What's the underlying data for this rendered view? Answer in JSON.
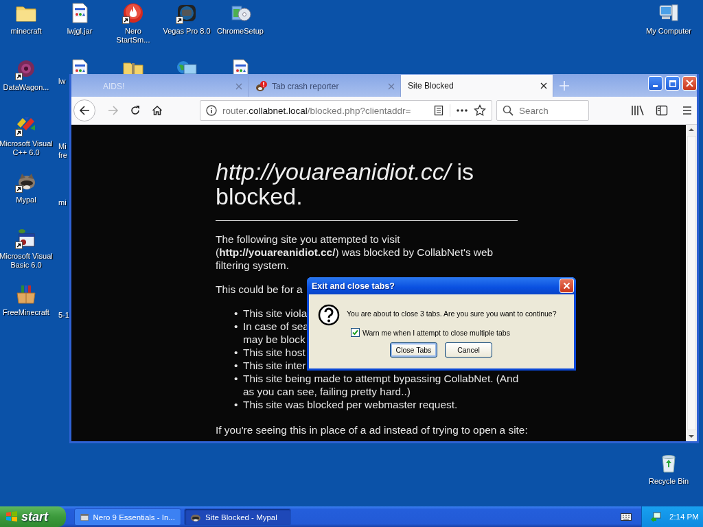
{
  "desktop": {
    "columns": [
      [
        {
          "label": "minecraft",
          "kind": "folder",
          "shortcut": false
        },
        {
          "label": "DataWagon...",
          "kind": "wagon",
          "shortcut": true
        },
        {
          "label": "Microsoft Visual\nC++ 6.0",
          "kind": "vcpp",
          "shortcut": true
        },
        {
          "label": "Mypal",
          "kind": "mypal",
          "shortcut": true
        },
        {
          "label": "Microsoft Visual\nBasic 6.0",
          "kind": "vb",
          "shortcut": true
        },
        {
          "label": "FreeMinecraft",
          "kind": "box",
          "shortcut": false
        }
      ],
      [
        {
          "label": "lwjgl.jar",
          "kind": "file",
          "shortcut": false,
          "covered": false
        },
        {
          "label": "lw",
          "kind": "file",
          "shortcut": false,
          "covered": true
        },
        {
          "label": "Mi\nfre",
          "kind": "hidden",
          "covered": true
        },
        {
          "label": "mi",
          "kind": "hidden",
          "covered": true
        },
        {
          "kind": "empty"
        },
        {
          "label": "5-1",
          "kind": "hidden",
          "covered": true
        }
      ],
      [
        {
          "label": "Nero\nStartSm...",
          "kind": "nero",
          "shortcut": true,
          "covered": false
        },
        {
          "kind": "zip",
          "shortcut": false,
          "covered": true
        }
      ],
      [
        {
          "label": "Vegas Pro 8.0",
          "kind": "vegas",
          "shortcut": true,
          "covered": false
        },
        {
          "kind": "network",
          "shortcut": false,
          "covered": true
        }
      ],
      [
        {
          "label": "ChromeSetup",
          "kind": "setup",
          "shortcut": false,
          "covered": false
        },
        {
          "kind": "file",
          "shortcut": false,
          "covered": true
        }
      ]
    ],
    "corner_icons": [
      {
        "label": "My Computer",
        "kind": "computer",
        "shortcut": false
      },
      {
        "label": "Recycle Bin",
        "kind": "recycle",
        "shortcut": false
      }
    ]
  },
  "browser": {
    "tabs": [
      {
        "label": "AIDS!",
        "selected": false,
        "kind": "closing"
      },
      {
        "label": "Tab crash reporter",
        "selected": false,
        "kind": "alert"
      },
      {
        "label": "Site Blocked",
        "selected": true,
        "kind": "plain"
      }
    ],
    "forward_enabled": false,
    "address": {
      "prefix": "router.",
      "domain": "collabnet.local",
      "path": "/blocked.php?clientaddr="
    },
    "search": {
      "placeholder": "Search"
    },
    "page": {
      "heading": "*http://youareanidiot.cc/* is blocked.",
      "intro": "The following site you attempted to visit (**http://youareanidiot.cc/**) was blocked by CollabNet's web filtering system.",
      "reasons_lead": "This could be for a",
      "reasons": [
        {
          "bullet": "•",
          "text": "This site viola"
        },
        {
          "bullet": "•",
          "text": "In case of sea\nmay be block"
        },
        {
          "bullet": "•",
          "text": "This site host"
        },
        {
          "bullet": "•",
          "text": "This site inter"
        },
        {
          "bullet": "•",
          "text": "This site being made to attempt bypassing CollabNet. (And as you can see, failing pretty hard..)"
        },
        {
          "bullet": "•",
          "text": "This site was blocked per webmaster request."
        }
      ],
      "footer": "If you're seeing this in place of a ad instead of trying to open a site:"
    }
  },
  "dialog": {
    "title": "Exit and close tabs?",
    "message": "You are about to close 3 tabs. Are you sure you want to continue?",
    "checkbox": {
      "label": "Warn me when I attempt to close multiple tabs",
      "checked": true
    },
    "buttons": [
      {
        "label": "Close Tabs",
        "focused": true
      },
      {
        "label": "Cancel",
        "focused": false
      }
    ]
  },
  "taskbar": {
    "start": "start",
    "tasks": [
      {
        "label": "Nero 9 Essentials - In...",
        "kind": "nero",
        "selected": false
      },
      {
        "label": "Site Blocked - Mypal",
        "kind": "mypal",
        "selected": true
      }
    ],
    "clock": "2:14 PM"
  }
}
